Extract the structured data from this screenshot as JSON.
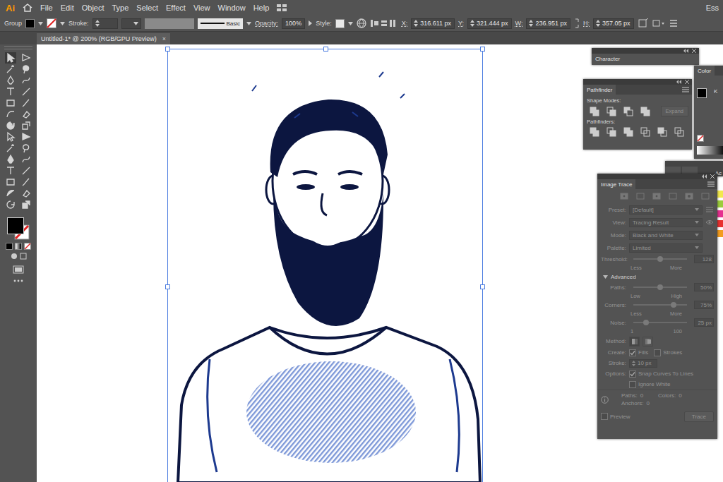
{
  "app": {
    "logo": "Ai"
  },
  "menu": [
    "File",
    "Edit",
    "Object",
    "Type",
    "Select",
    "Effect",
    "View",
    "Window",
    "Help"
  ],
  "workspace": "Ess",
  "control_bar": {
    "selection": "Group",
    "stroke_label": "Stroke:",
    "stroke_profile": "Basic",
    "opacity_label": "Opacity:",
    "opacity": "100%",
    "style_label": "Style:",
    "fields": [
      {
        "label": "X:",
        "value": "316.611 px"
      },
      {
        "label": "Y:",
        "value": "321.444 px"
      },
      {
        "label": "W:",
        "value": "236.951 px"
      },
      {
        "label": "H:",
        "value": "357.05 px"
      }
    ]
  },
  "document_tab": {
    "title": "Untitled-1* @ 200% (RGB/GPU Preview)",
    "close": "×"
  },
  "panels": {
    "character": {
      "title": "Character"
    },
    "color": {
      "title": "Color",
      "channel": "K"
    },
    "pathfinder": {
      "title": "Pathfinder",
      "shape_modes": "Shape Modes:",
      "expand": {
        "label": "Expand",
        "disabled": true
      },
      "pathfinders": "Pathfinders:"
    },
    "actions": {
      "title": "Ac"
    },
    "swatches": [
      {
        "color": "#f2e94e"
      },
      {
        "color": "#9ccc3c"
      },
      {
        "color": "#e5318f"
      },
      {
        "color": "#e8312f"
      },
      {
        "color": "#f39c1f"
      }
    ],
    "image_trace": {
      "title": "Image Trace",
      "disabled": true,
      "dropdowns": [
        {
          "label": "Preset:",
          "value": "[Default]"
        },
        {
          "label": "View:",
          "value": "Tracing Result"
        },
        {
          "label": "Mode:",
          "value": "Black and White"
        },
        {
          "label": "Palette:",
          "value": "Limited"
        }
      ],
      "threshold": {
        "label": "Threshold:",
        "value": "128",
        "level": 0.5,
        "min": "Less",
        "max": "More"
      },
      "advanced": {
        "label": "Advanced",
        "expanded": true
      },
      "sliders": [
        {
          "label": "Paths:",
          "value": "50%",
          "level": 0.5,
          "min": "Low",
          "max": "High"
        },
        {
          "label": "Corners:",
          "value": "75%",
          "level": 0.75,
          "min": "Less",
          "max": "More"
        },
        {
          "label": "Noise:",
          "value": "25 px",
          "level": 0.24,
          "min": "1",
          "max": "100"
        }
      ],
      "method": {
        "label": "Method:"
      },
      "create": {
        "label": "Create:",
        "options": [
          {
            "label": "Fills",
            "checked": true
          },
          {
            "label": "Strokes",
            "checked": false
          }
        ]
      },
      "stroke": {
        "label": "Stroke:",
        "value": "10 px"
      },
      "options": {
        "label": "Options:",
        "items": [
          {
            "label": "Snap Curves To Lines",
            "checked": true
          },
          {
            "label": "Ignore White",
            "checked": false
          }
        ]
      },
      "stats": [
        {
          "label": "Paths:",
          "value": "0"
        },
        {
          "label": "Colors:",
          "value": "0"
        },
        {
          "label": "Anchors:",
          "value": "0"
        }
      ],
      "preview": {
        "label": "Preview",
        "checked": false
      },
      "trace_button": "Trace"
    }
  }
}
